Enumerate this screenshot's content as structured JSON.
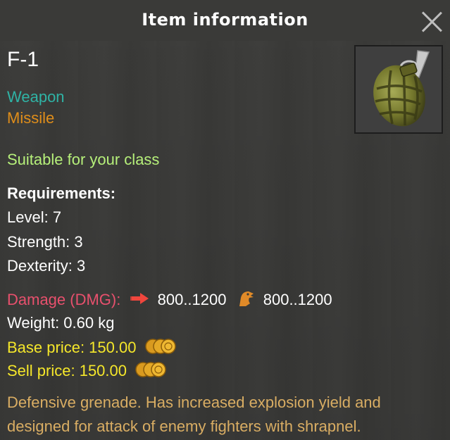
{
  "dialog": {
    "title": "Item information"
  },
  "item": {
    "name": "F-1",
    "category": "Weapon",
    "subtype": "Missile",
    "class_note": "Suitable for your class",
    "requirements_label": "Requirements:",
    "requirements": [
      "Level: 7",
      "Strength: 3",
      "Dexterity: 3"
    ],
    "damage_label": "Damage (DMG):",
    "damage_values": [
      "800..1200",
      "800..1200"
    ],
    "weight": "Weight: 0.60 kg",
    "base_price": "Base price: 150.00",
    "sell_price": "Sell price: 150.00",
    "description": "Defensive grenade. Has increased explosion yield and designed for attack of enemy fighters with shrapnel."
  },
  "icons": {
    "close": "close-icon",
    "item_image": "grenade-icon",
    "damage_type_1": "arrow-right-icon",
    "damage_type_2": "eagle-head-icon",
    "currency": "gold-coins-icon"
  },
  "colors": {
    "category": "#2fb3a5",
    "subtype": "#e08e1a",
    "class_note": "#b6f07a",
    "damage_label": "#e8506d",
    "price": "#f5e72a",
    "description": "#d9ad63"
  }
}
